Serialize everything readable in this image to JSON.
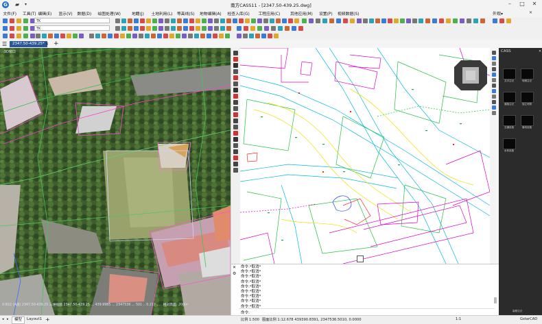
{
  "window": {
    "app_logo": "G",
    "title": "南方CASS11 - [2347.50-439.25.dwg]",
    "controls": {
      "minimize": "–",
      "maximize": "□",
      "close": "✕"
    }
  },
  "menu": {
    "items": [
      "文件(F)",
      "工具(T)",
      "编辑(E)",
      "显示(V)",
      "数据(D)",
      "绘图处理(W)",
      "地籍(J)",
      "土地利用(L)",
      "等高线(S)",
      "地物编辑(A)",
      "检查入库(G)",
      "工程应用(C)",
      "其他应用(M)",
      "设置(P)",
      "视频数据(S)"
    ],
    "right_label": "外观▾"
  },
  "toolbar": {
    "layer_name": "TK",
    "layer_name2": "TK",
    "annot_num": "3"
  },
  "document": {
    "tab_label": "2347.50-439.25*",
    "add_tab": "+",
    "view_label": "-3D窗口"
  },
  "viewport3d": {
    "status_text": "X:822 (A值) 2347.50-439.25 三维视图 2347.50-439.25 ... 439.9985 ... 2347536 ... 501 .. 0.217    ..... 相对高度: 200m"
  },
  "command": {
    "lines": [
      "命令:*取消*",
      "命令:*取消*",
      "命令:*取消*",
      "命令:*取消*",
      "命令:*取消*",
      "命令:*取消*",
      "命令:*取消*",
      "命令:*取消*",
      "命令:*取消*"
    ],
    "prompt": "命令:"
  },
  "palette": {
    "title": "CASS",
    "tiles": [
      {
        "label": "文字注记"
      },
      {
        "label": "地貌注记"
      },
      {
        "label": "道路注记"
      },
      {
        "label": "独立地物"
      },
      {
        "label": "交通设施"
      },
      {
        "label": "管线设施"
      },
      {
        "label": "水系设施"
      }
    ],
    "footer": "高程注记"
  },
  "statusbar": {
    "layout_model": "模型",
    "layout_1": "Layout1",
    "add": "+",
    "scale": "比例 1:500",
    "coords": "图面比例 1:12.678  439390.8391, 2347536.5010, 0.0000",
    "zoom": "1:1",
    "brand": "GstarCAD"
  },
  "colors": {
    "accent": "#2b5797",
    "cad_bg": "#ffffff",
    "palette_bg": "#2b2b2b"
  }
}
